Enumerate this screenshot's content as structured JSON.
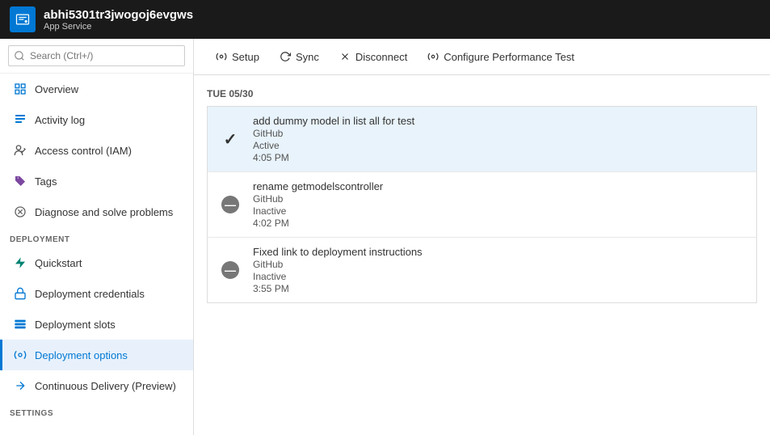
{
  "header": {
    "app_name": "abhi5301tr3jwogoj6evgws",
    "page_title": "Deployment options",
    "subtitle": "App Service",
    "icon_label": "app-service-icon"
  },
  "sidebar": {
    "search_placeholder": "Search (Ctrl+/)",
    "items": [
      {
        "id": "overview",
        "label": "Overview",
        "icon": "overview",
        "active": false
      },
      {
        "id": "activity-log",
        "label": "Activity log",
        "icon": "activity-log",
        "active": false
      },
      {
        "id": "access-control",
        "label": "Access control (IAM)",
        "icon": "access-control",
        "active": false
      },
      {
        "id": "tags",
        "label": "Tags",
        "icon": "tags",
        "active": false
      },
      {
        "id": "diagnose",
        "label": "Diagnose and solve problems",
        "icon": "diagnose",
        "active": false
      }
    ],
    "sections": [
      {
        "label": "DEPLOYMENT",
        "items": [
          {
            "id": "quickstart",
            "label": "Quickstart",
            "icon": "quickstart",
            "active": false
          },
          {
            "id": "deployment-credentials",
            "label": "Deployment credentials",
            "icon": "deployment-credentials",
            "active": false
          },
          {
            "id": "deployment-slots",
            "label": "Deployment slots",
            "icon": "deployment-slots",
            "active": false
          },
          {
            "id": "deployment-options",
            "label": "Deployment options",
            "icon": "deployment-options",
            "active": true
          },
          {
            "id": "continuous-delivery",
            "label": "Continuous Delivery (Preview)",
            "icon": "continuous-delivery",
            "active": false
          }
        ]
      },
      {
        "label": "SETTINGS",
        "items": []
      }
    ]
  },
  "toolbar": {
    "buttons": [
      {
        "id": "setup",
        "label": "Setup",
        "icon": "gear"
      },
      {
        "id": "sync",
        "label": "Sync",
        "icon": "sync"
      },
      {
        "id": "disconnect",
        "label": "Disconnect",
        "icon": "disconnect"
      },
      {
        "id": "configure-perf",
        "label": "Configure Performance Test",
        "icon": "gear"
      }
    ]
  },
  "content": {
    "date_label": "TUE 05/30",
    "deployments": [
      {
        "id": "deploy-1",
        "title": "add dummy model in list all for test",
        "source": "GitHub",
        "status": "Active",
        "time": "4:05 PM",
        "icon_type": "check",
        "selected": true
      },
      {
        "id": "deploy-2",
        "title": "rename getmodelscontroller",
        "source": "GitHub",
        "status": "Inactive",
        "time": "4:02 PM",
        "icon_type": "dash",
        "selected": false
      },
      {
        "id": "deploy-3",
        "title": "Fixed link to deployment instructions",
        "source": "GitHub",
        "status": "Inactive",
        "time": "3:55 PM",
        "icon_type": "dash",
        "selected": false
      }
    ]
  }
}
